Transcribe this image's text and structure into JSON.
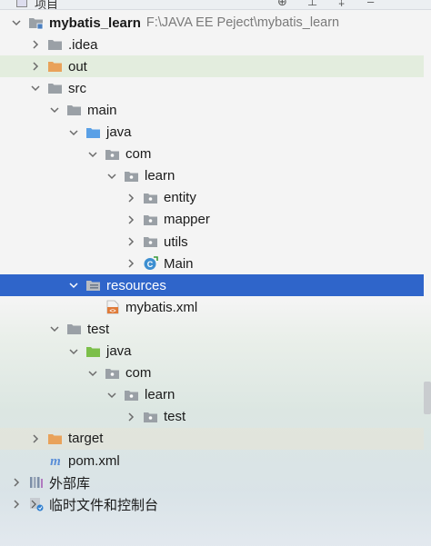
{
  "window": {
    "title": "项目"
  },
  "colors": {
    "selection": "#2f65ca",
    "folder_gray": "#9aa0a6",
    "folder_blue": "#5aa0e6",
    "folder_green": "#7cbf4a",
    "folder_orange": "#e9a25a",
    "java_class": "#3d8fd1"
  },
  "tree": [
    {
      "label": "mybatis_learn",
      "path": "F:\\JAVA EE Peject\\mybatis_learn",
      "level": 0,
      "chevron": "down",
      "icon": "module-folder-icon",
      "bold": true
    },
    {
      "label": ".idea",
      "level": 1,
      "chevron": "right",
      "icon": "folder-gray-icon"
    },
    {
      "label": "out",
      "level": 1,
      "chevron": "right",
      "icon": "folder-orange-icon",
      "highlight": "green"
    },
    {
      "label": "src",
      "level": 1,
      "chevron": "down",
      "icon": "folder-gray-icon"
    },
    {
      "label": "main",
      "level": 2,
      "chevron": "down",
      "icon": "folder-gray-icon"
    },
    {
      "label": "java",
      "level": 3,
      "chevron": "down",
      "icon": "folder-blue-icon"
    },
    {
      "label": "com",
      "level": 4,
      "chevron": "down",
      "icon": "package-icon"
    },
    {
      "label": "learn",
      "level": 5,
      "chevron": "down",
      "icon": "package-icon"
    },
    {
      "label": "entity",
      "level": 6,
      "chevron": "right",
      "icon": "package-icon"
    },
    {
      "label": "mapper",
      "level": 6,
      "chevron": "right",
      "icon": "package-icon"
    },
    {
      "label": "utils",
      "level": 6,
      "chevron": "right",
      "icon": "package-icon"
    },
    {
      "label": "Main",
      "level": 6,
      "chevron": "right",
      "icon": "java-class-icon"
    },
    {
      "label": "resources",
      "level": 3,
      "chevron": "down",
      "icon": "resources-folder-icon",
      "selected": true
    },
    {
      "label": "mybatis.xml",
      "level": 4,
      "chevron": "none",
      "icon": "xml-file-icon"
    },
    {
      "label": "test",
      "level": 2,
      "chevron": "down",
      "icon": "folder-gray-icon"
    },
    {
      "label": "java",
      "level": 3,
      "chevron": "down",
      "icon": "folder-green-icon"
    },
    {
      "label": "com",
      "level": 4,
      "chevron": "down",
      "icon": "package-icon"
    },
    {
      "label": "learn",
      "level": 5,
      "chevron": "down",
      "icon": "package-icon"
    },
    {
      "label": "test",
      "level": 6,
      "chevron": "right",
      "icon": "package-icon"
    },
    {
      "label": "target",
      "level": 1,
      "chevron": "right",
      "icon": "folder-orange-icon",
      "highlight": "orange"
    },
    {
      "label": "pom.xml",
      "level": 1,
      "chevron": "none",
      "icon": "maven-pom-icon"
    },
    {
      "label": "外部库",
      "level": 0,
      "chevron": "right",
      "icon": "external-libraries-icon"
    },
    {
      "label": "临时文件和控制台",
      "level": 0,
      "chevron": "right",
      "icon": "scratches-icon"
    }
  ]
}
